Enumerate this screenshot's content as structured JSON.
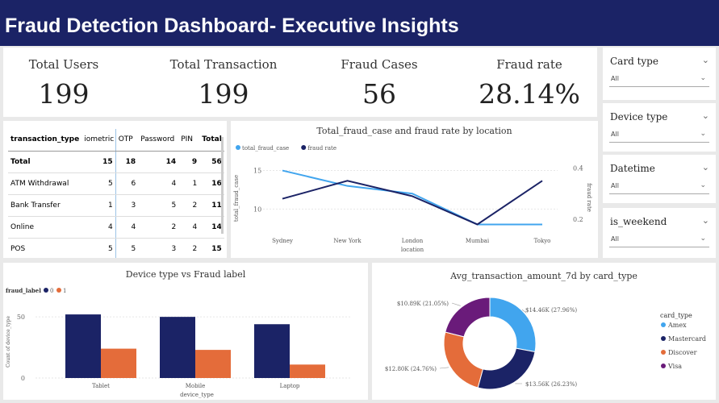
{
  "header": {
    "title": "Fraud Detection Dashboard- Executive Insights"
  },
  "kpis": [
    {
      "label": "Total Users",
      "value": "199"
    },
    {
      "label": "Total Transaction",
      "value": "199"
    },
    {
      "label": "Fraud Cases",
      "value": "56"
    },
    {
      "label": "Fraud rate",
      "value": "28.14%"
    }
  ],
  "slicers": [
    {
      "label": "Card type",
      "value": "All"
    },
    {
      "label": "Device type",
      "value": "All"
    },
    {
      "label": "Datetime",
      "value": "All"
    },
    {
      "label": "is_weekend",
      "value": "All"
    }
  ],
  "matrix": {
    "headers": [
      "transaction_type",
      "iometric",
      "OTP",
      "Password",
      "PIN",
      "Total"
    ],
    "rows": [
      {
        "label": "Total",
        "cells": [
          "15",
          "18",
          "14",
          "9",
          "56"
        ]
      },
      {
        "label": "ATM Withdrawal",
        "cells": [
          "5",
          "6",
          "4",
          "1",
          "16"
        ]
      },
      {
        "label": "Bank Transfer",
        "cells": [
          "1",
          "3",
          "5",
          "2",
          "11"
        ]
      },
      {
        "label": "Online",
        "cells": [
          "4",
          "4",
          "2",
          "4",
          "14"
        ]
      },
      {
        "label": "POS",
        "cells": [
          "5",
          "5",
          "3",
          "2",
          "15"
        ]
      }
    ]
  },
  "colors": {
    "light_blue": "#41a5ee",
    "navy": "#1b2366",
    "orange": "#e46c3a",
    "purple": "#6a1b7a",
    "mid_blue": "#2f3a9a"
  },
  "chart_data": [
    {
      "type": "line",
      "title": "Total_fraud_case and fraud rate by location",
      "xlabel": "location",
      "ylabel": "total_fraud_case",
      "y2label": "fraud rate",
      "categories": [
        "Sydney",
        "New York",
        "London",
        "Mumbai",
        "Tokyo"
      ],
      "series": [
        {
          "name": "total_fraud_case",
          "axis": "left",
          "color": "#41a5ee",
          "values": [
            15,
            13,
            12,
            8,
            8
          ]
        },
        {
          "name": "fraud rate",
          "axis": "right",
          "color": "#1b2366",
          "values": [
            0.28,
            0.35,
            0.29,
            0.18,
            0.35
          ]
        }
      ],
      "y_ticks": [
        "15",
        "10"
      ],
      "y2_ticks": [
        "0.4",
        "0.2"
      ],
      "ylim": [
        7,
        16
      ],
      "y2lim": [
        0.15,
        0.42
      ],
      "legend": "top-left"
    },
    {
      "type": "bar",
      "title": "Device type vs Fraud label",
      "xlabel": "device_type",
      "ylabel": "Count of device_type",
      "legend_title": "fraud_label",
      "categories": [
        "Tablet",
        "Mobile",
        "Laptop"
      ],
      "series": [
        {
          "name": "0",
          "color": "#1b2366",
          "values": [
            52,
            50,
            44
          ]
        },
        {
          "name": "1",
          "color": "#e46c3a",
          "values": [
            24,
            23,
            11
          ]
        }
      ],
      "y_ticks": [
        "50",
        "0"
      ],
      "ylim": [
        0,
        58
      ]
    },
    {
      "type": "pie",
      "title": "Avg_transaction_amount_7d by card_type",
      "legend_title": "card_type",
      "slices": [
        {
          "name": "Amex",
          "value": 14.46,
          "label": "$14.46K (27.96%)",
          "color": "#41a5ee"
        },
        {
          "name": "Mastercard",
          "value": 13.56,
          "label": "$13.56K (26.23%)",
          "color": "#1b2366"
        },
        {
          "name": "Discover",
          "value": 12.8,
          "label": "$12.80K (24.76%)",
          "color": "#e46c3a"
        },
        {
          "name": "Visa",
          "value": 10.89,
          "label": "$10.89K (21.05%)",
          "color": "#6a1b7a"
        }
      ],
      "legend": "right"
    }
  ]
}
